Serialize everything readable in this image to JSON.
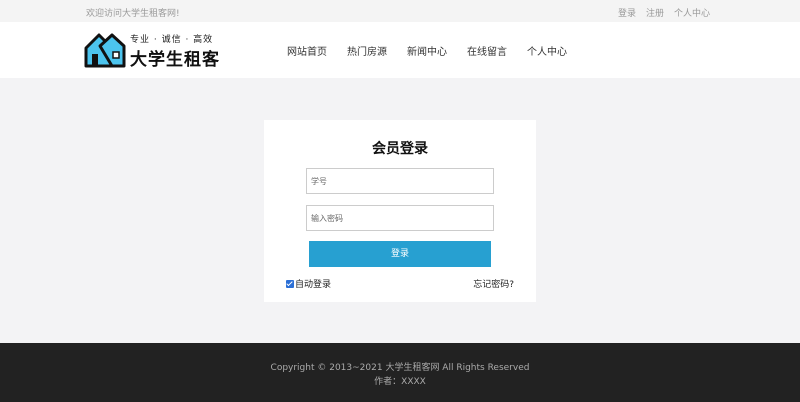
{
  "topbar": {
    "welcome": "欢迎访问大学生租客网!",
    "links": [
      "登录",
      "注册",
      "个人中心"
    ]
  },
  "logo": {
    "slogan": "专业 · 诚信 · 高效",
    "name": "大学生租客"
  },
  "nav": [
    "网站首页",
    "热门房源",
    "新闻中心",
    "在线留言",
    "个人中心"
  ],
  "login": {
    "title": "会员登录",
    "username_placeholder": "学号",
    "password_placeholder": "输入密码",
    "submit_label": "登录",
    "remember_label": "自动登录",
    "remember_checked": true,
    "forgot_label": "忘记密码?"
  },
  "footer": {
    "copyright": "Copyright © 2013~2021 大学生租客网 All Rights Reserved",
    "author": "作者：XXXX"
  },
  "colors": {
    "accent": "#27a0d1",
    "footer_bg": "#222222",
    "page_bg": "#f3f3f5"
  }
}
